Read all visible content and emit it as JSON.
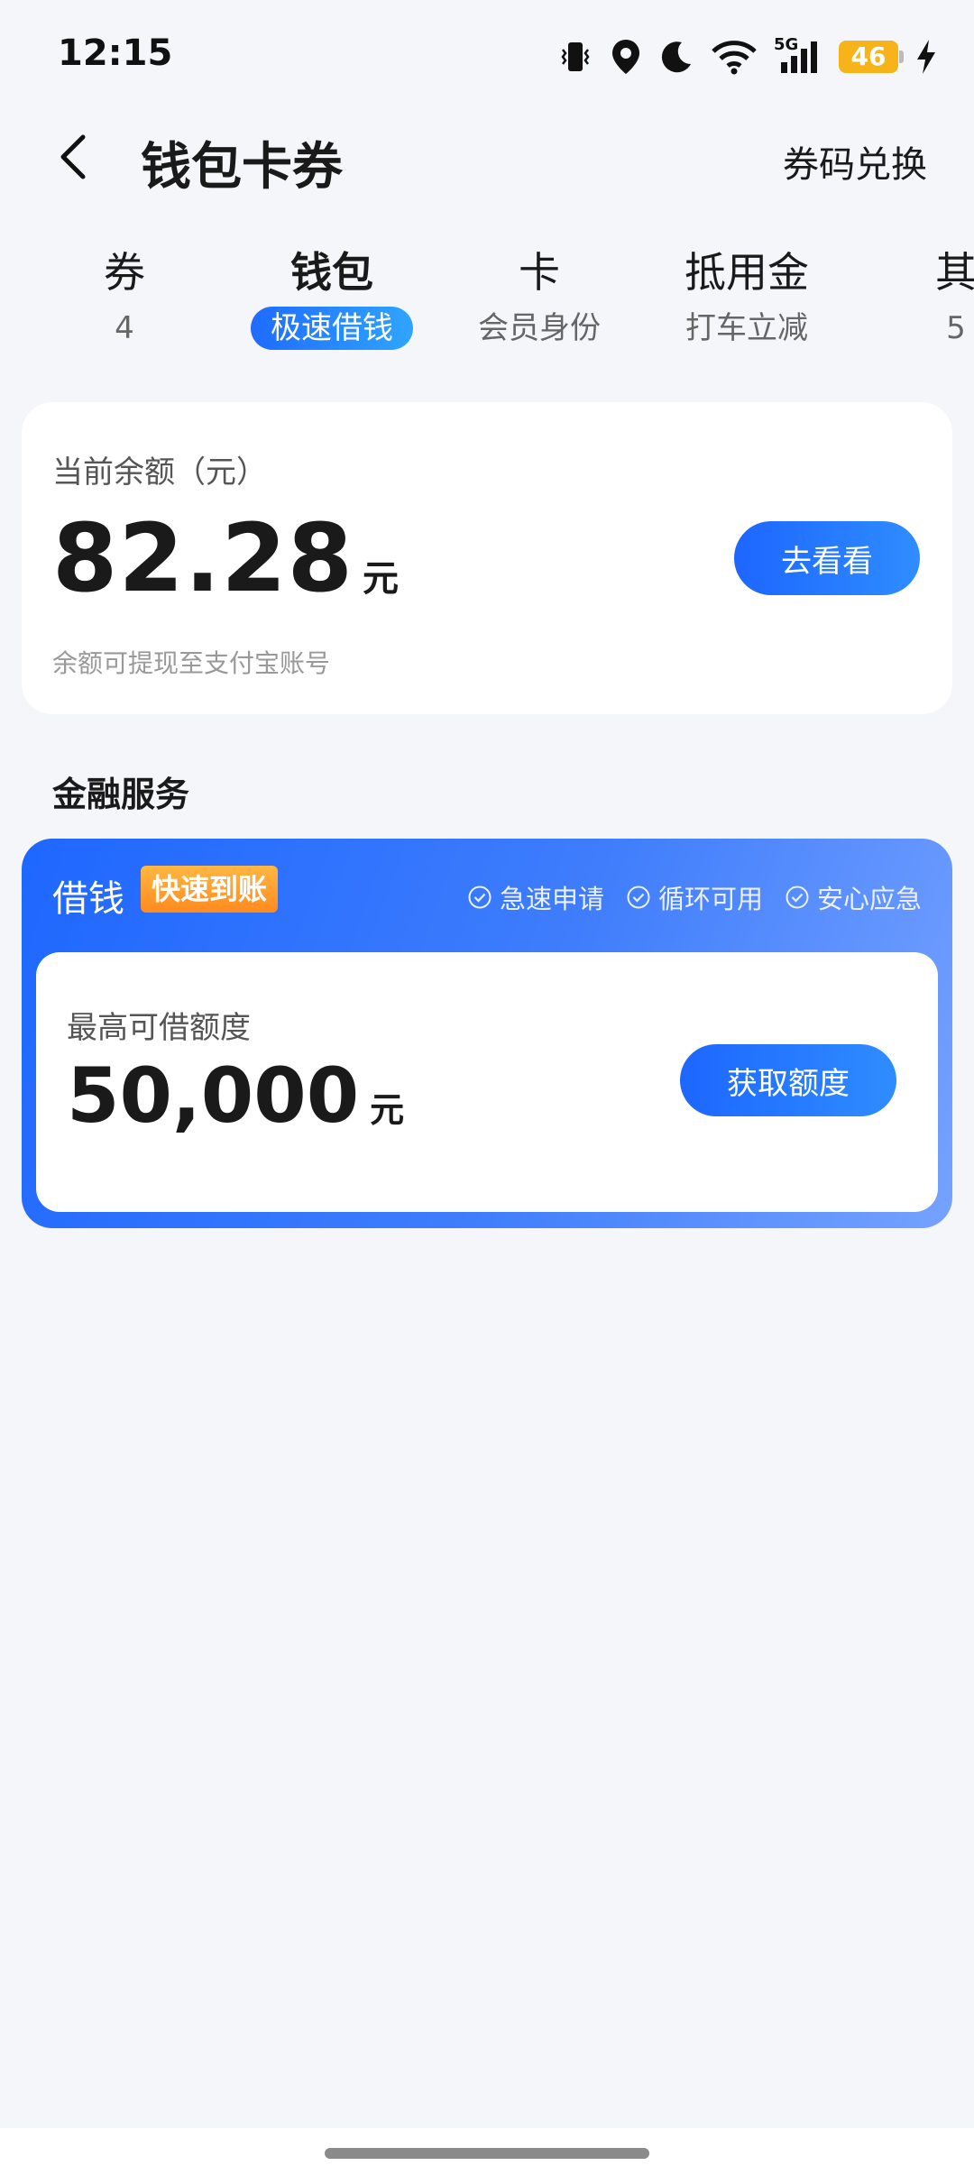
{
  "status_bar": {
    "time": "12:15",
    "network_label": "5G",
    "battery_level": "46",
    "icons": [
      "vibrate-icon",
      "location-icon",
      "moon-icon",
      "wifi-icon",
      "signal-icon",
      "battery-icon",
      "charging-icon"
    ]
  },
  "header": {
    "title": "钱包卡券",
    "redeem_label": "券码兑换",
    "back_icon": "back-arrow-icon"
  },
  "tabs": [
    {
      "label": "券",
      "sub": "4"
    },
    {
      "label": "钱包",
      "sub": "极速借钱",
      "active": true
    },
    {
      "label": "卡",
      "sub": "会员身份"
    },
    {
      "label": "抵用金",
      "sub": "打车立减"
    },
    {
      "label": "其",
      "sub": "5"
    }
  ],
  "balance": {
    "label": "当前余额（元）",
    "value": "82.28",
    "unit": "元",
    "note": "余额可提现至支付宝账号",
    "button_label": "去看看"
  },
  "finance": {
    "section_title": "金融服务",
    "loan_title": "借钱",
    "badge": "快速到账",
    "features": [
      "急速申请",
      "循环可用",
      "安心应急"
    ],
    "limit_label": "最高可借额度",
    "limit_value": "50,000",
    "limit_unit": "元",
    "button_label": "获取额度"
  },
  "colors": {
    "accent": "#1f6bff",
    "badge": "#ff9a2a",
    "battery": "#f6b41a",
    "background": "#f4f6f9"
  }
}
